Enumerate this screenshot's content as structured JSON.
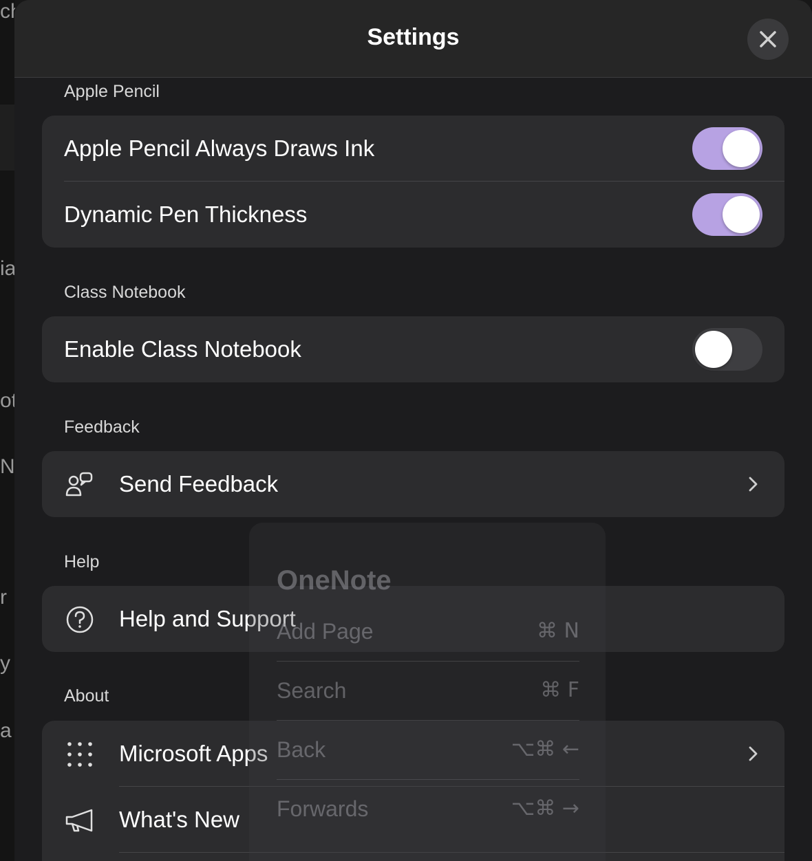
{
  "background_fragments": [
    "ch",
    "ia",
    "ot",
    "N",
    "r",
    "y",
    "a"
  ],
  "header": {
    "title": "Settings",
    "close_icon": "close-icon"
  },
  "sections": {
    "apple_pencil": {
      "label": "Apple Pencil",
      "rows": [
        {
          "label": "Apple Pencil Always Draws Ink",
          "toggle": true
        },
        {
          "label": "Dynamic Pen Thickness",
          "toggle": true
        }
      ]
    },
    "class_notebook": {
      "label": "Class Notebook",
      "rows": [
        {
          "label": "Enable Class Notebook",
          "toggle": false
        }
      ]
    },
    "feedback": {
      "label": "Feedback",
      "rows": [
        {
          "label": "Send Feedback",
          "icon": "feedback-icon"
        }
      ]
    },
    "help": {
      "label": "Help",
      "rows": [
        {
          "label": "Help and Support",
          "icon": "help-icon"
        }
      ]
    },
    "about": {
      "label": "About",
      "rows": [
        {
          "label": "Microsoft Apps",
          "icon": "apps-grid-icon"
        },
        {
          "label": "What's New",
          "icon": "megaphone-icon"
        }
      ]
    }
  },
  "colors": {
    "toggle_on": "#b7a2e3",
    "toggle_off": "#3e3e41",
    "sheet_bg": "#1c1c1e",
    "group_bg": "#2c2c2e"
  },
  "shortcut_hud": {
    "title": "OneNote",
    "items": [
      {
        "name": "Add Page",
        "keys": "⌘ N"
      },
      {
        "name": "Search",
        "keys": "⌘ F"
      },
      {
        "name": "Back",
        "keys": "⌥⌘ ←"
      },
      {
        "name": "Forwards",
        "keys": "⌥⌘ →"
      }
    ]
  }
}
